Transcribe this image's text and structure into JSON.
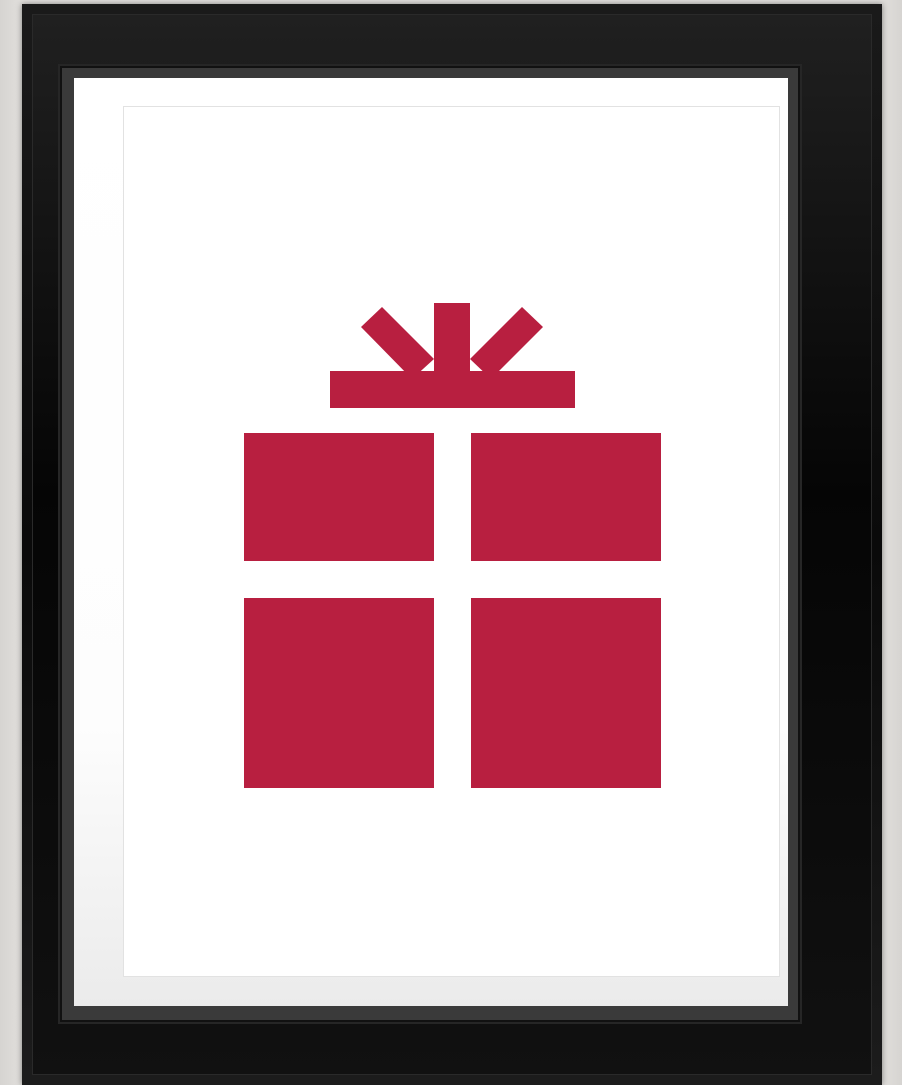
{
  "artwork": {
    "subject": "gift-icon",
    "colors": {
      "gift": "#b81f40",
      "paper": "#ffffff",
      "frame": "#0c0c0c",
      "mat": "#ffffff",
      "wall": "#e4e2df"
    }
  }
}
